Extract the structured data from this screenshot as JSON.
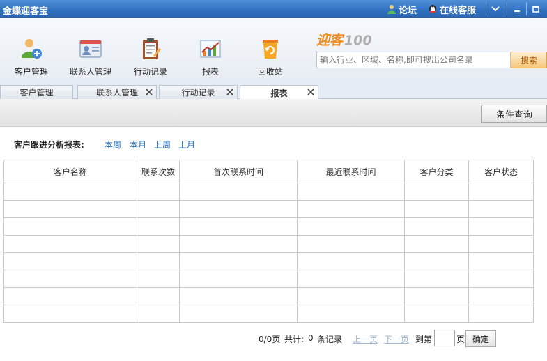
{
  "titlebar": {
    "title": "金蝶迎客宝",
    "forum_label": "论坛",
    "service_label": "在线客服"
  },
  "toolbar": {
    "items": [
      {
        "label": "客户管理",
        "icon": "customer-icon"
      },
      {
        "label": "联系人管理",
        "icon": "contact-card-icon"
      },
      {
        "label": "行动记录",
        "icon": "clipboard-icon"
      },
      {
        "label": "报表",
        "icon": "chart-icon"
      },
      {
        "label": "回收站",
        "icon": "recycle-bin-icon"
      }
    ]
  },
  "search": {
    "logo_text": "迎客100",
    "placeholder": "输入行业、区域、名称,即可搜出公司名录",
    "button_label": "搜索"
  },
  "tabs": [
    {
      "label": "客户管理",
      "active": false,
      "closable": false
    },
    {
      "label": "联系人管理",
      "active": false,
      "closable": true
    },
    {
      "label": "行动记录",
      "active": false,
      "closable": true
    },
    {
      "label": "报表",
      "active": true,
      "closable": true
    }
  ],
  "filter": {
    "button_label": "条件查询"
  },
  "report": {
    "label": "客户跟进分析报表:",
    "periods": [
      "本周",
      "本月",
      "上周",
      "上月"
    ]
  },
  "table": {
    "columns": [
      "客户名称",
      "联系次数",
      "首次联系时间",
      "最近联系时间",
      "客户分类",
      "客户状态"
    ],
    "empty_rows": 8
  },
  "pager": {
    "page_info": "0/0页",
    "total_label": "共计:",
    "total_count": "0",
    "records_label": "条记录",
    "prev_label": "上一页",
    "next_label": "下一页",
    "goto_label": "到第",
    "page_unit": "页",
    "confirm_label": "确定"
  },
  "colors": {
    "titlebar": "#2f6fbf",
    "link": "#1a67b5",
    "search_button": "#f5c77a"
  }
}
